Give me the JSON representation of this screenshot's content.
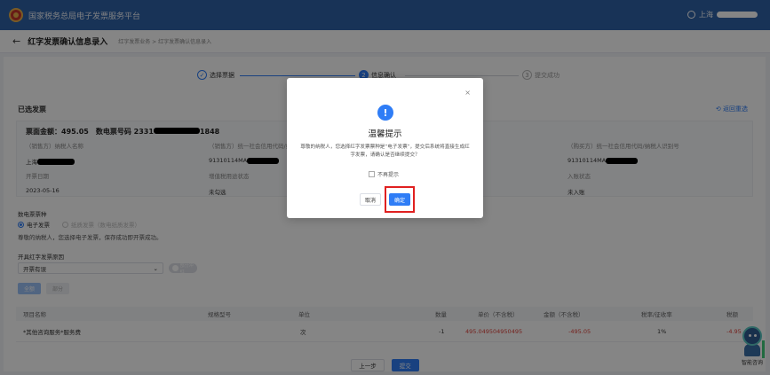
{
  "app": {
    "title": "国家税务总局电子发票服务平台",
    "user_prefix": "上海"
  },
  "header": {
    "back": "←",
    "page_title": "红字发票确认信息录入",
    "breadcrumb": "红字发票业务 > 红字发票确认信息录入"
  },
  "steps": [
    {
      "num": "✓",
      "label": "选择票据"
    },
    {
      "num": "2",
      "label": "信息确认"
    },
    {
      "num": "3",
      "label": "提交成功"
    }
  ],
  "section": {
    "title": "已选发票",
    "reselect": "⟲ 返回重选"
  },
  "invoice": {
    "amount_label": "票面金额：",
    "amount": "495.05",
    "number_label": "数电票号码",
    "number_prefix": "2331",
    "number_suffix": "1848",
    "seller_label": "（销售方）纳税人名称",
    "seller_value": "上海",
    "seller_code_label": "（销售方）统一社会信用代码/纳税人识别号",
    "seller_code_value": "91310114MA",
    "buyer_code_label": "（购买方）统一社会信用代码/纳税人识别号",
    "buyer_code_value": "91310114MA",
    "date_label": "开票日期",
    "date_value": "2023-05-16",
    "vat_label": "增值税用途状态",
    "vat_value": "未勾选",
    "entry_label": "入账状态",
    "entry_value": "未入账"
  },
  "form": {
    "type_label": "数电票票种",
    "radio_electronic": "电子发票",
    "radio_paper": "纸质发票（数电纸质发票）",
    "hint": "尊敬的纳税人，您选择电子发票，保存成功即开票成功。",
    "reason_label": "开具红字发票原因",
    "reason_value": "开票有误",
    "toggle_text": "部分冲红",
    "btn_a": "全额",
    "btn_b": "部分"
  },
  "table": {
    "headers": [
      "项目名称",
      "规格型号",
      "单位",
      "数量",
      "单价（不含税）",
      "金额（不含税）",
      "税率/征收率",
      "税额"
    ],
    "rows": [
      [
        "*其他咨询服务*服务费",
        "",
        "次",
        "-1",
        "495.049504950495",
        "-495.05",
        "1%",
        "-4.95"
      ]
    ]
  },
  "footer": {
    "prev": "上一步",
    "submit": "提交"
  },
  "assistant": {
    "label": "智能咨询"
  },
  "modal": {
    "close": "×",
    "icon": "!",
    "title": "温馨提示",
    "message": "尊敬的纳税人，您选择红字发票票种是“电子发票”，提交后系统将直接生成红字发票，请确认是否继续提交？",
    "checkbox": "不再提示",
    "cancel": "取消",
    "confirm": "确定"
  },
  "colors": {
    "brand": "#2f62a8",
    "primary": "#2f7df6",
    "negative": "#e0413a",
    "highlight": "#e02020"
  }
}
